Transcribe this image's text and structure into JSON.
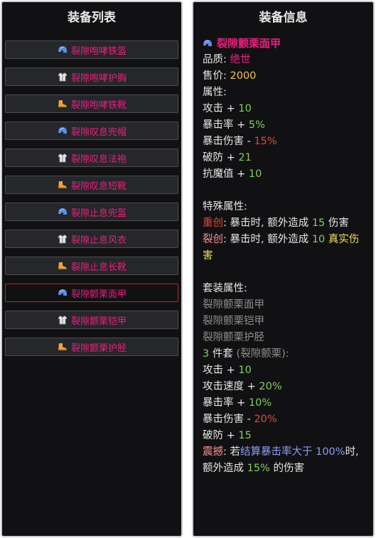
{
  "left": {
    "title": "装备列表",
    "items": [
      {
        "label": "裂隙咆哮铁盔",
        "icon": "helmet-icon"
      },
      {
        "label": "裂隙咆哮护胸",
        "icon": "chest-armor-icon"
      },
      {
        "label": "裂隙咆哮铁靴",
        "icon": "boot-icon"
      },
      {
        "label": "裂隙叹息兜帽",
        "icon": "helmet-icon"
      },
      {
        "label": "裂隙叹息法袍",
        "icon": "chest-armor-icon"
      },
      {
        "label": "裂隙叹息短靴",
        "icon": "boot-icon"
      },
      {
        "label": "裂隙止息兜盔",
        "icon": "helmet-icon"
      },
      {
        "label": "裂隙止息风衣",
        "icon": "chest-armor-icon"
      },
      {
        "label": "裂隙止息长靴",
        "icon": "boot-icon"
      },
      {
        "label": "裂隙颤栗面甲",
        "icon": "helmet-icon",
        "selected": true
      },
      {
        "label": "裂隙颤栗铠甲",
        "icon": "chest-armor-icon"
      },
      {
        "label": "裂隙颤栗护胫",
        "icon": "boot-icon"
      }
    ]
  },
  "right": {
    "title": "装备信息",
    "item_name": "裂隙颤栗面甲",
    "item_icon": "helmet-icon",
    "quality_label": "品质:",
    "quality_value": "绝世",
    "price_label": "售价:",
    "price_value": "2000",
    "attr_label": "属性:",
    "attrs": [
      {
        "name": "攻击",
        "op": "+",
        "value": "10"
      },
      {
        "name": "暴击率",
        "op": "+",
        "value": "5%"
      },
      {
        "name": "暴击伤害",
        "op": "-",
        "value": "15%"
      },
      {
        "name": "破防",
        "op": "+",
        "value": "21"
      },
      {
        "name": "抗魔值",
        "op": "+",
        "value": "10"
      }
    ],
    "special_label": "特殊属性:",
    "special": [
      {
        "name": "重创",
        "desc_before": ": 暴击时, 额外造成",
        "value": "15",
        "desc_after": "伤害"
      },
      {
        "name": "裂创",
        "desc_before": ": 暴击时, 额外造成",
        "value": "10",
        "desc_after": "真实伤害"
      }
    ],
    "set_label": "套装属性:",
    "set_pieces": [
      "裂隙颤栗面甲",
      "裂隙颤栗铠甲",
      "裂隙颤栗护胫"
    ],
    "set_count": "3",
    "set_count_text": "件套",
    "set_name": "(裂隙颤栗):",
    "set_attrs": [
      {
        "name": "攻击",
        "op": "+",
        "value": "10"
      },
      {
        "name": "攻击速度",
        "op": "+",
        "value": "20%"
      },
      {
        "name": "暴击率",
        "op": "+",
        "value": "10%"
      },
      {
        "name": "暴击伤害",
        "op": "-",
        "value": "20%"
      },
      {
        "name": "破防",
        "op": "+",
        "value": "15"
      }
    ],
    "set_special": {
      "name": "震撼",
      "colon": ": 若",
      "cond": "结算暴击率大于 100%",
      "mid": "时, 额外造成",
      "value": "15%",
      "tail": "的伤害"
    }
  }
}
